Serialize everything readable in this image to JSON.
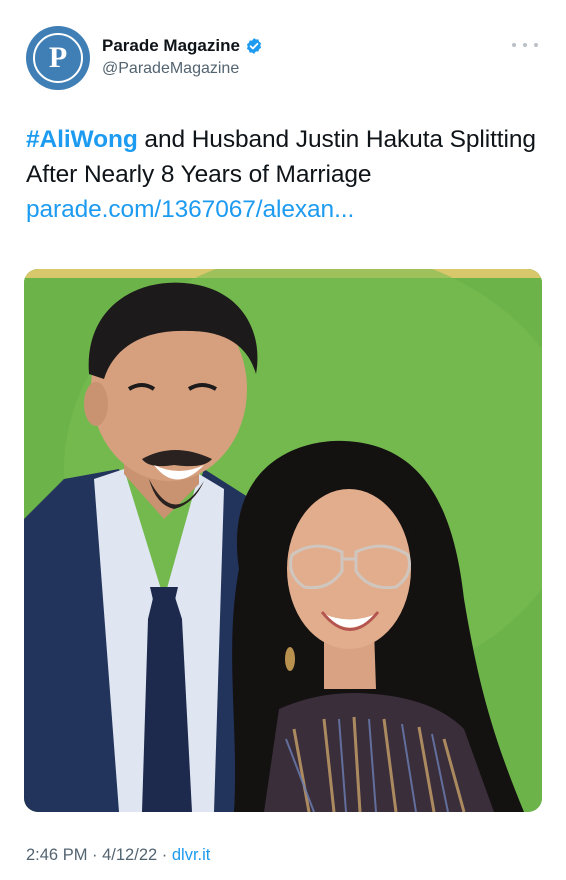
{
  "account": {
    "avatar_letter": "P",
    "display_name": "Parade Magazine",
    "handle": "@ParadeMagazine",
    "verified": true,
    "avatar_color": "#3f7fb5"
  },
  "tweet": {
    "hashtag": "#AliWong",
    "text_after_hashtag": " and Husband Justin Hakuta Splitting After Nearly 8 Years of Marriage ",
    "link_text": "parade.com/1367067/alexan..."
  },
  "meta": {
    "time": "2:46 PM",
    "separator_1": " · ",
    "date": "4/12/22",
    "separator_2": " · ",
    "source": "dlvr.it"
  },
  "colors": {
    "link": "#1d9bf0",
    "secondary_text": "#536471",
    "photo_background": "#6db44a"
  }
}
